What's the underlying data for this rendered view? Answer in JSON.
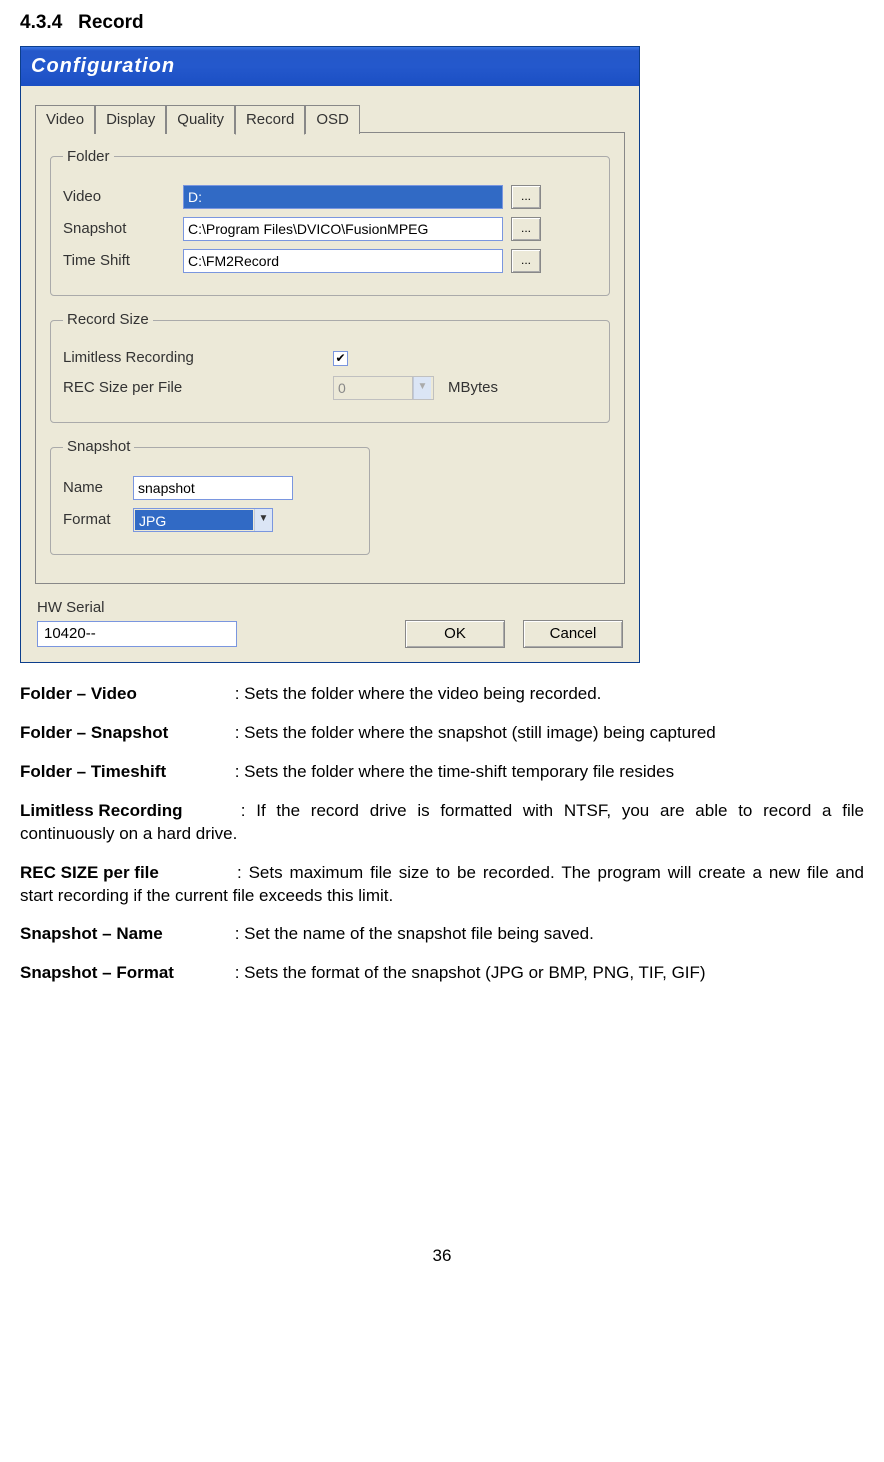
{
  "section_number": "4.3.4",
  "section_title": "Record",
  "dialog": {
    "title": "Configuration",
    "tabs": {
      "video": "Video",
      "display": "Display",
      "quality": "Quality",
      "record": "Record",
      "osd": "OSD"
    },
    "folder": {
      "legend": "Folder",
      "video_label": "Video",
      "video_value": "D:",
      "snapshot_label": "Snapshot",
      "snapshot_value": "C:\\Program Files\\DVICO\\FusionMPEG",
      "timeshift_label": "Time Shift",
      "timeshift_value": "C:\\FM2Record",
      "browse": "..."
    },
    "record_size": {
      "legend": "Record Size",
      "limitless_label": "Limitless Recording",
      "limitless_checked": "✔",
      "rec_size_label": "REC Size per File",
      "rec_size_value": "0",
      "unit": "MBytes"
    },
    "snapshot": {
      "legend": "Snapshot",
      "name_label": "Name",
      "name_value": "snapshot",
      "format_label": "Format",
      "format_value": "JPG"
    },
    "hw_serial_label": "HW Serial",
    "hw_serial_value": "10420--",
    "ok": "OK",
    "cancel": "Cancel"
  },
  "descriptions": {
    "folder_video_label": "Folder – Video",
    "folder_video_text": ": Sets the folder where the video being recorded.",
    "folder_snapshot_label": "Folder – Snapshot",
    "folder_snapshot_text": ": Sets the folder where the snapshot (still image) being captured",
    "folder_timeshift_label": "Folder – Timeshift",
    "folder_timeshift_text": ": Sets the folder where the time-shift temporary file resides",
    "limitless_label": "Limitless Recording",
    "limitless_text": ": If the record drive is formatted with NTSF,  you are able to record a file continuously on a hard drive.",
    "recsize_label": "REC SIZE per file",
    "recsize_text": ": Sets maximum file size to be recorded. The program will create a new file and start recording if the current file exceeds this limit.",
    "snap_name_label": "Snapshot – Name",
    "snap_name_text": ": Set the name of the snapshot file being saved.",
    "snap_format_label": "Snapshot – Format",
    "snap_format_text": ": Sets the format of the snapshot (JPG or BMP, PNG, TIF, GIF)"
  },
  "page_number": "36"
}
